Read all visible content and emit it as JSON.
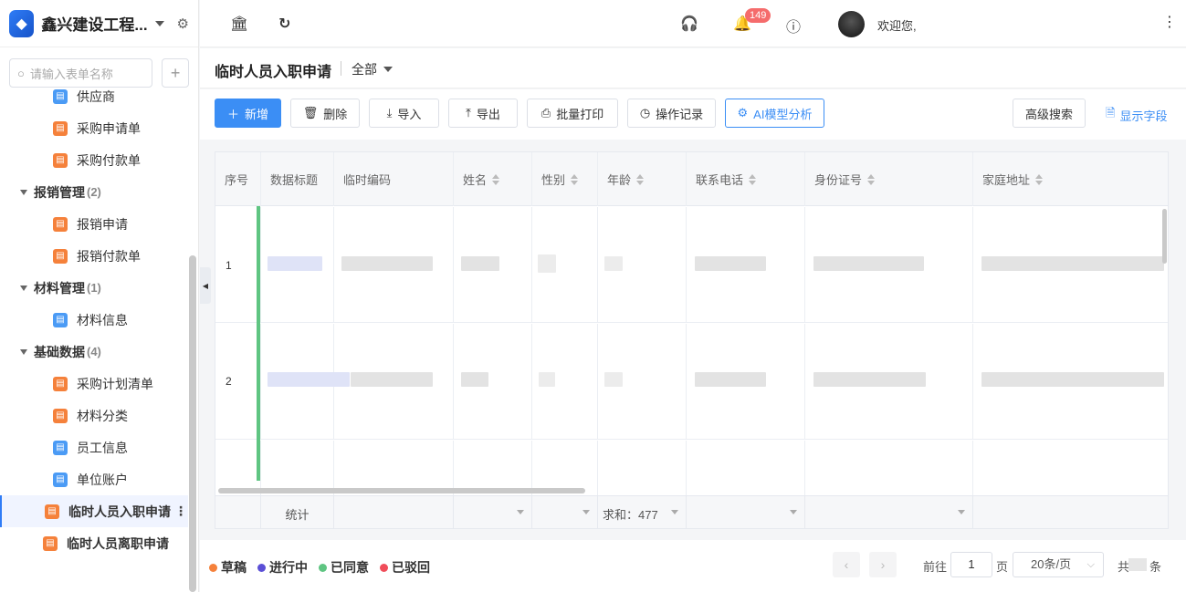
{
  "app": {
    "name": "鑫兴建设工程..."
  },
  "search": {
    "placeholder": "请输入表单名称"
  },
  "sidebar": {
    "items_top": [
      "供应商",
      "采购申请单",
      "采购付款单"
    ],
    "group_reimb": {
      "label": "报销管理",
      "count": "(2)"
    },
    "items_reimb": [
      "报销申请",
      "报销付款单"
    ],
    "group_material": {
      "label": "材料管理",
      "count": "(1)"
    },
    "items_material": [
      "材料信息"
    ],
    "group_base": {
      "label": "基础数据",
      "count": "(4)"
    },
    "items_base": [
      "采购计划清单",
      "材料分类",
      "员工信息",
      "单位账户"
    ],
    "active_item": "临时人员入职申请",
    "last_item": "临时人员离职申请"
  },
  "topbar": {
    "notification_count": "149",
    "welcome": "欢迎您,"
  },
  "page": {
    "title": "临时人员入职申请",
    "filter": "全部"
  },
  "toolbar": {
    "add": "新增",
    "delete": "删除",
    "import": "导入",
    "export": "导出",
    "batch_print": "批量打印",
    "op_log": "操作记录",
    "ai_analysis": "AI模型分析",
    "advanced_search": "高级搜索",
    "show_fields": "显示字段"
  },
  "table": {
    "columns": [
      "序号",
      "数据标题",
      "临时编码",
      "姓名",
      "性别",
      "年龄",
      "联系电话",
      "身份证号",
      "家庭地址"
    ],
    "rows": [
      {
        "index": "1"
      },
      {
        "index": "2"
      }
    ],
    "footer_label": "统计",
    "footer_sum": "求和：477"
  },
  "legend": [
    {
      "label": "草稿",
      "color": "#f5813b"
    },
    {
      "label": "进行中",
      "color": "#5b4fd6"
    },
    {
      "label": "已同意",
      "color": "#5fc582"
    },
    {
      "label": "已驳回",
      "color": "#f04d5a"
    }
  ],
  "pagination": {
    "goto": "前往",
    "page_value": "1",
    "page_unit": "页",
    "page_size": "20条/页",
    "total_prefix": "共",
    "total_suffix": "条"
  }
}
